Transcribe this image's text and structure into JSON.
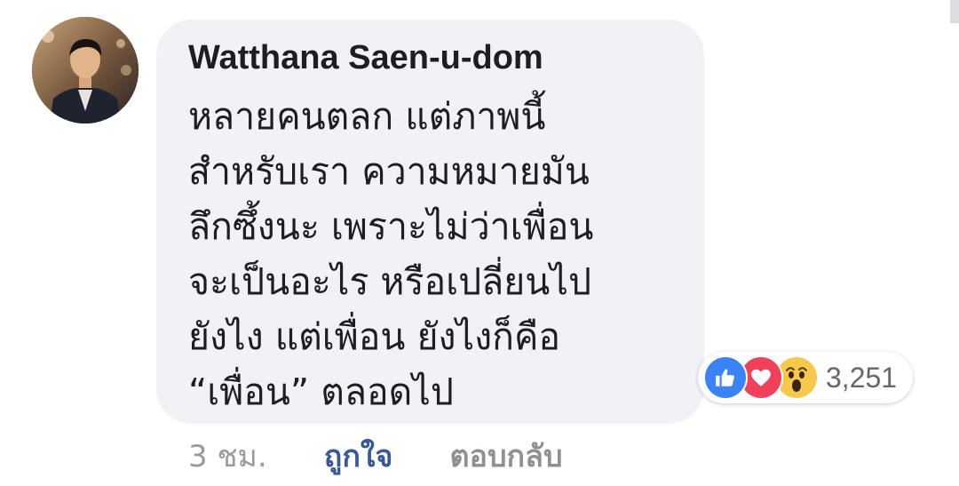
{
  "comment": {
    "author": "Watthana Saen-u-dom",
    "lines": [
      "หลายคนตลก แต่ภาพนี้",
      "สำหรับเรา ความหมายมัน",
      "ลึกซึ้งนะ เพราะไม่ว่าเพื่อน",
      "จะเป็นอะไร หรือเปลี่ยนไป",
      "ยังไง แต่เพื่อน ยังไงก็คือ",
      "“เพื่อน” ตลอดไป"
    ]
  },
  "reactions": {
    "icons": [
      "like-icon",
      "love-icon",
      "wow-icon"
    ],
    "count": "3,251"
  },
  "actions": {
    "time": "3 ชม.",
    "like": "ถูกใจ",
    "reply": "ตอบกลับ"
  },
  "colors": {
    "bubble": "#f1f2f6",
    "link": "#385898",
    "like_reaction": "#3b82f6",
    "love_reaction": "#f0415a",
    "wow_reaction": "#f7c94a"
  }
}
